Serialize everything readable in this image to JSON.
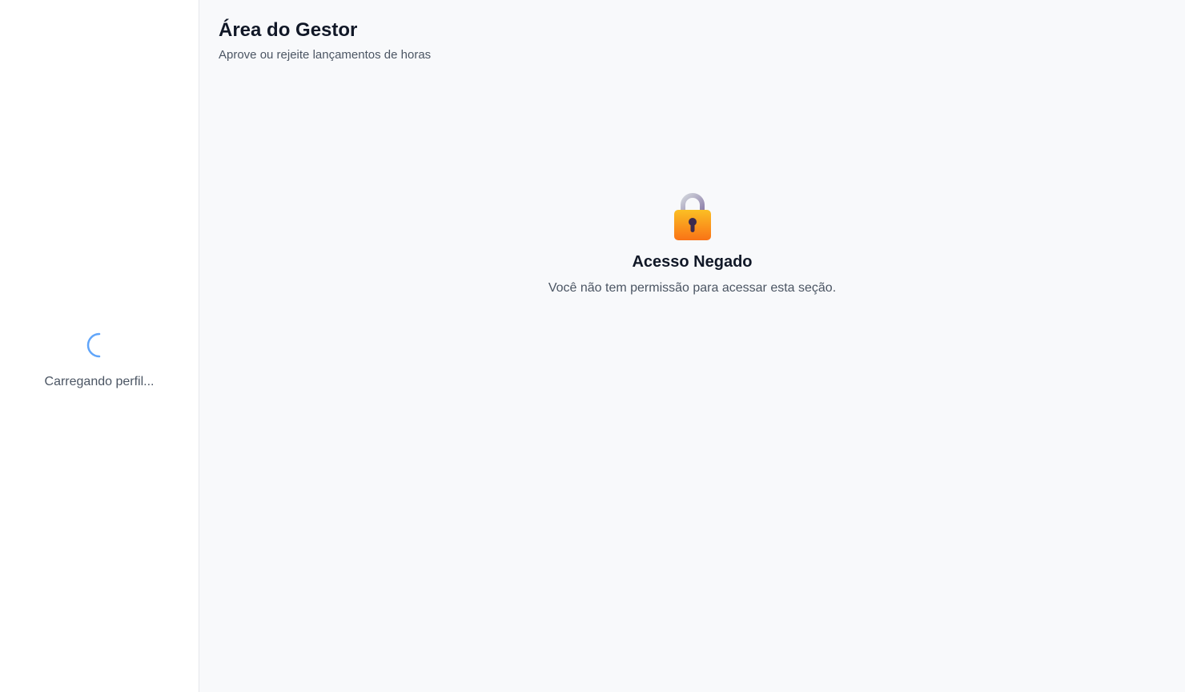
{
  "sidebar": {
    "loading_icon": "spinner-icon",
    "loading_text": "Carregando perfil..."
  },
  "header": {
    "title": "Área do Gestor",
    "subtitle": "Aprove ou rejeite lançamentos de horas"
  },
  "access_denied": {
    "icon": "lock-icon",
    "title": "Acesso Negado",
    "message": "Você não tem permissão para acessar esta seção."
  },
  "colors": {
    "background": "#f8f9fb",
    "sidebar_background": "#ffffff",
    "spinner": "#3b82f6",
    "lock_body": "#f59e0b",
    "lock_shackle": "#9ca3af"
  }
}
